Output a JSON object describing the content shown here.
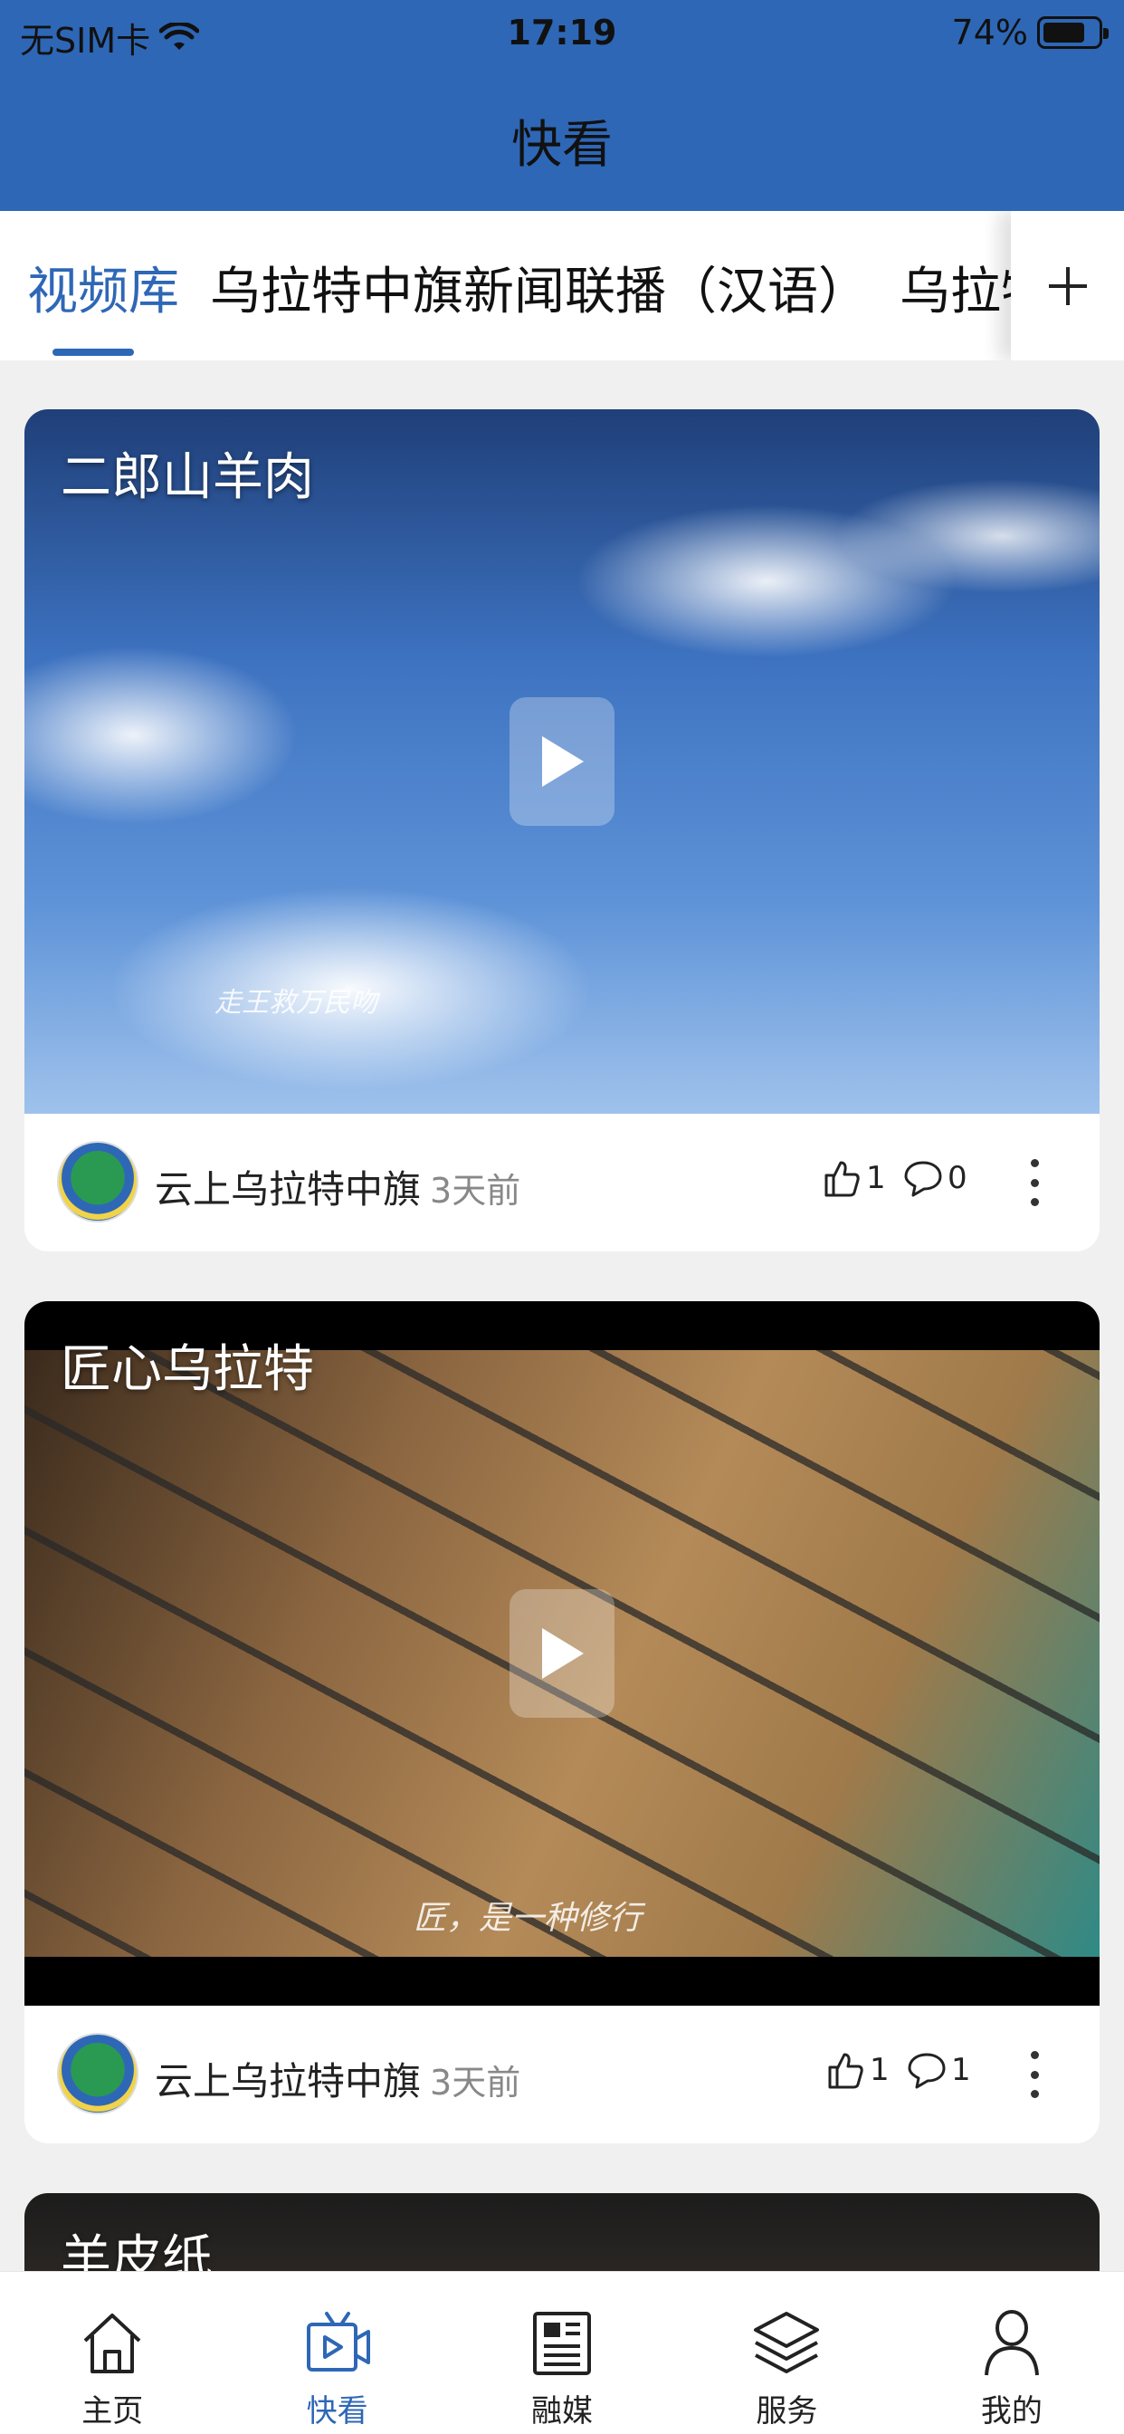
{
  "status_bar": {
    "carrier": "无SIM卡",
    "time": "17:19",
    "battery": "74%",
    "battery_level": 0.74
  },
  "header": {
    "title": "快看"
  },
  "tabs": [
    {
      "label": "视频库",
      "active": true
    },
    {
      "label": "乌拉特中旗新闻联播（汉语）",
      "active": false
    },
    {
      "label": "乌拉特中旗",
      "active": false
    }
  ],
  "tab_more_icon": "plus-icon",
  "cards": [
    {
      "title": "二郎山羊肉",
      "subtitle": "走王救万民吻",
      "source": "云上乌拉特中旗",
      "age": "3天前",
      "likes": "1",
      "comments": "0"
    },
    {
      "title": "匠心乌拉特",
      "subtitle": "匠，是一种修行",
      "source": "云上乌拉特中旗",
      "age": "3天前",
      "likes": "1",
      "comments": "1"
    },
    {
      "title": "羊皮纸"
    }
  ],
  "bottom_nav": [
    {
      "label": "主页",
      "icon": "home-icon",
      "active": false
    },
    {
      "label": "快看",
      "icon": "video-icon",
      "active": true
    },
    {
      "label": "融媒",
      "icon": "newspaper-icon",
      "active": false
    },
    {
      "label": "服务",
      "icon": "layers-icon",
      "active": false
    },
    {
      "label": "我的",
      "icon": "person-icon",
      "active": false
    }
  ],
  "colors": {
    "brand": "#2e67b6",
    "background": "#f0f0f0"
  }
}
